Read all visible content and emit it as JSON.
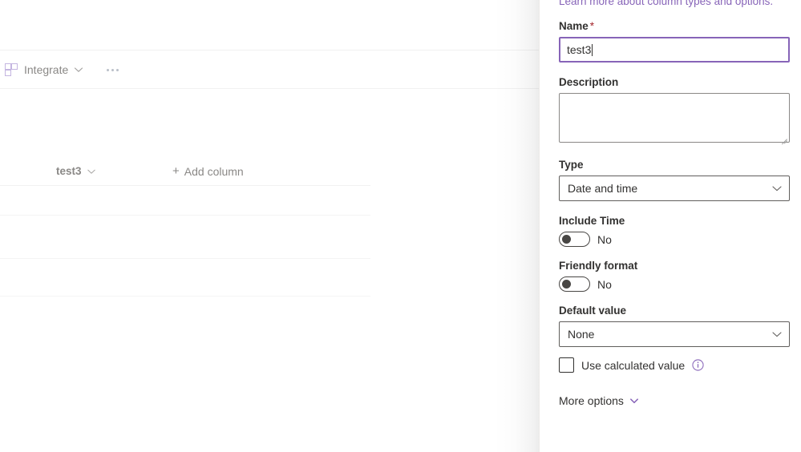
{
  "list": {
    "command_bar": {
      "integrate_label": "Integrate",
      "integrate_icon": "integrate-grid-icon",
      "chevron_icon": "chevron-down-icon",
      "overflow_label": "More commands",
      "overflow_icon": "ellipsis-icon"
    },
    "columns": [
      {
        "label": "test3",
        "chevron_icon": "chevron-down-icon"
      }
    ],
    "add_column_label": "Add column",
    "add_column_icon": "plus-icon",
    "row_count": 3
  },
  "panel": {
    "learn_more_link": "Learn more about column types and options.",
    "name": {
      "label": "Name",
      "required_marker": "*",
      "value": "test3",
      "placeholder": ""
    },
    "description": {
      "label": "Description",
      "value": "",
      "placeholder": ""
    },
    "type": {
      "label": "Type",
      "value": "Date and time",
      "chevron_icon": "chevron-down-icon",
      "options": [
        "Date and time"
      ]
    },
    "include_time": {
      "label": "Include Time",
      "state_text": "No",
      "checked": false
    },
    "friendly_format": {
      "label": "Friendly format",
      "state_text": "No",
      "checked": false
    },
    "default_value": {
      "label": "Default value",
      "value": "None",
      "chevron_icon": "chevron-down-icon",
      "options": [
        "None"
      ]
    },
    "use_calculated_value": {
      "label": "Use calculated value",
      "checked": false,
      "info_icon": "info-circle-icon"
    },
    "more_options": {
      "label": "More options",
      "chevron_icon": "chevron-down-icon"
    }
  },
  "colors": {
    "accent_purple": "#8764b8",
    "link_purple": "#8764b8",
    "required_red": "#a4262c",
    "text_primary": "#323130",
    "text_secondary": "#8a8886",
    "border_gray": "#605e5c"
  }
}
